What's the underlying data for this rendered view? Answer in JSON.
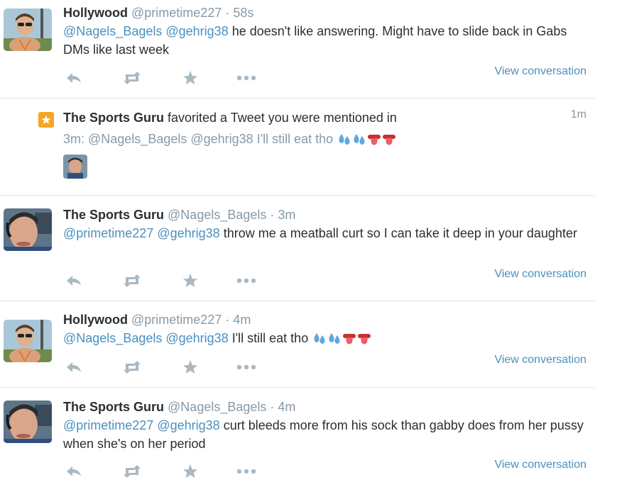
{
  "tweets": [
    {
      "name": "Hollywood",
      "handle": "@primetime227",
      "dot": "·",
      "time": "58s",
      "mention1": "@Nagels_Bagels",
      "mention2": "@gehrig38",
      "text": " he doesn't like answering. Might have to slide back in Gabs DMs like last week",
      "view_conversation": "View conversation"
    },
    {
      "name": "The Sports Guru",
      "handle": "@Nagels_Bagels",
      "dot": "·",
      "time": "3m",
      "mention1": "@primetime227",
      "mention2": "@gehrig38",
      "text": " throw me a meatball curt so I can take it deep in your daughter",
      "view_conversation": "View conversation"
    },
    {
      "name": "Hollywood",
      "handle": "@primetime227",
      "dot": "·",
      "time": "4m",
      "mention1": "@Nagels_Bagels",
      "mention2": "@gehrig38",
      "text": " I'll still eat tho",
      "view_conversation": "View conversation"
    },
    {
      "name": "The Sports Guru",
      "handle": "@Nagels_Bagels",
      "dot": "·",
      "time": "4m",
      "mention1": "@primetime227",
      "mention2": "@gehrig38",
      "text": " curt bleeds more from his sock than gabby does from her pussy when she's on her period",
      "view_conversation": "View conversation"
    }
  ],
  "notification": {
    "actor": "The Sports Guru",
    "action": " favorited a Tweet you were mentioned in",
    "time": "1m",
    "quote": "3m: @Nagels_Bagels @gehrig38 I'll still eat tho"
  },
  "icons": {
    "reply": "reply-icon",
    "retweet": "retweet-icon",
    "favorite": "star-icon",
    "more": "more-icon",
    "sweat": "sweat-droplets-icon",
    "tongue": "tongue-icon"
  },
  "colors": {
    "link": "#4a90c0",
    "meta": "#8899a6",
    "text": "#292f33",
    "action_icon": "#aab8c2",
    "favorite_badge": "#f5a623",
    "divider": "#e1e8ed"
  }
}
